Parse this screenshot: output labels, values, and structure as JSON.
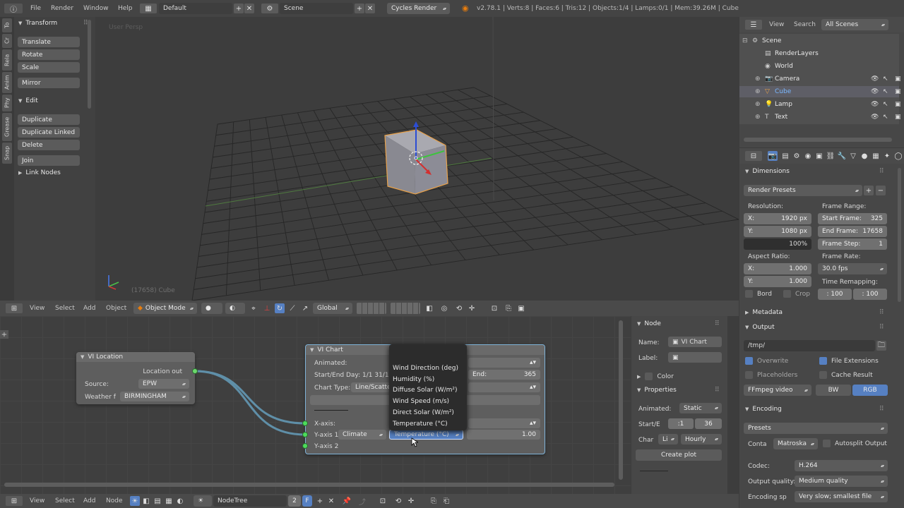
{
  "top_bar": {
    "menus": [
      "File",
      "Render",
      "Window",
      "Help"
    ],
    "layout": "Default",
    "scene": "Scene",
    "engine": "Cycles Render",
    "stats": "v2.78.1 | Verts:8 | Faces:6 | Tris:12 | Objects:1/4 | Lamps:0/1 | Mem:39.26M | Cube"
  },
  "left_tabs": [
    "To",
    "Cr",
    "Rela",
    "Anim",
    "Phy",
    "Grease",
    "Snap"
  ],
  "tool_shelf": {
    "transform_header": "Transform",
    "transform_buttons": [
      "Translate",
      "Rotate",
      "Scale",
      "Mirror"
    ],
    "edit_header": "Edit",
    "edit_buttons": [
      "Duplicate",
      "Duplicate Linked",
      "Delete",
      "Join"
    ],
    "link_nodes": "Link Nodes"
  },
  "viewport": {
    "label": "User Persp",
    "object_label": "(17658) Cube"
  },
  "viewport_header": {
    "menus": [
      "View",
      "Select",
      "Add",
      "Object"
    ],
    "mode": "Object Mode",
    "orientation": "Global"
  },
  "outliner": {
    "view": "View",
    "search": "Search",
    "filter": "All Scenes",
    "items": [
      {
        "name": "Scene",
        "indent": 0
      },
      {
        "name": "RenderLayers",
        "indent": 1
      },
      {
        "name": "World",
        "indent": 1
      },
      {
        "name": "Camera",
        "indent": 1
      },
      {
        "name": "Cube",
        "indent": 1
      },
      {
        "name": "Lamp",
        "indent": 1
      },
      {
        "name": "Text",
        "indent": 1
      }
    ]
  },
  "properties": {
    "dimensions": "Dimensions",
    "render_presets": "Render Presets",
    "resolution_label": "Resolution:",
    "res_x": "1920 px",
    "res_y": "1080 px",
    "res_pct": "100%",
    "frame_range_label": "Frame Range:",
    "start_frame_label": "Start Frame:",
    "start_frame": "325",
    "end_frame_label": "End Frame:",
    "end_frame": "17658",
    "frame_step_label": "Frame Step:",
    "frame_step": "1",
    "aspect_label": "Aspect Ratio:",
    "aspect_x": "1.000",
    "aspect_y": "1.000",
    "frame_rate_label": "Frame Rate:",
    "frame_rate": "30.0 fps",
    "bord": "Bord",
    "crop": "Crop",
    "time_remap_label": "Time Remapping:",
    "remap_old": ": 100",
    "remap_new": ": 100",
    "metadata": "Metadata",
    "output": "Output",
    "path": "/tmp/",
    "overwrite": "Overwrite",
    "file_ext": "File Extensions",
    "placeholders": "Placeholders",
    "cache_result": "Cache Result",
    "format": "FFmpeg video",
    "bw": "BW",
    "rgb": "RGB",
    "encoding": "Encoding",
    "presets": "Presets",
    "container_label": "Conta",
    "container": "Matroska",
    "autosplit": "Autosplit Output",
    "codec_label": "Codec:",
    "codec": "H.264",
    "quality_label": "Output quality:",
    "quality": "Medium quality",
    "speed_label": "Encoding sp",
    "speed": "Very slow; smallest file"
  },
  "node_location": {
    "title": "VI Location",
    "output": "Location out",
    "source_label": "Source:",
    "source": "EPW",
    "weather_label": "Weather f",
    "weather": "BIRMINGHAM"
  },
  "node_chart": {
    "title": "VI Chart",
    "animated_label": "Animated:",
    "start_end": "Start/End Day: 1/1 31/12",
    "end_label": "End:",
    "end_value": "365",
    "chart_type_label": "Chart Type:",
    "chart_type": "Line/Scatter",
    "xaxis": "X-axis:",
    "yaxis1": "Y-axis 1:",
    "climate": "Climate",
    "temperature_selected": "Temperature (°C)",
    "yvalue": "1.00",
    "yaxis2": "Y-axis 2"
  },
  "dropdown": {
    "options": [
      "Wind Direction (deg)",
      "Humidity (%)",
      "Diffuse Solar (W/m²)",
      "Wind Speed (m/s)",
      "Direct Solar (W/m²)",
      "Temperature (°C)"
    ]
  },
  "node_sidebar": {
    "node_header": "Node",
    "name_label": "Name:",
    "name": "VI Chart",
    "label_label": "Label:",
    "color": "Color",
    "properties": "Properties",
    "animated_label": "Animated:",
    "animated": "Static",
    "start_label": "Start/E",
    "start_val": ":1",
    "end_val": "36",
    "char_label": "Char",
    "char_val": "Li",
    "freq": "Hourly",
    "create_plot": "Create plot"
  },
  "node_header": {
    "menus": [
      "View",
      "Select",
      "Add",
      "Node"
    ],
    "tree": "NodeTree",
    "users": "2",
    "fake": "F"
  }
}
